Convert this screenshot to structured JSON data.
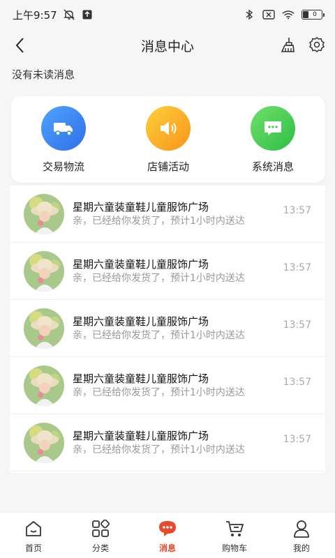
{
  "status_bar": {
    "time": "上午9:57",
    "battery_level": "0"
  },
  "header": {
    "title": "消息中心"
  },
  "unread_text": "没有未读消息",
  "categories": [
    {
      "label": "交易物流",
      "color": "#3a86f0",
      "icon": "truck-icon"
    },
    {
      "label": "店铺活动",
      "color": "#f7a51b",
      "icon": "speaker-icon"
    },
    {
      "label": "系统消息",
      "color": "#3ec94e",
      "icon": "chat-bubble-icon"
    }
  ],
  "messages": [
    {
      "name": "星期六童装童鞋儿童服饰广场",
      "preview": "亲，已经给你发货了，预计1小时内送达",
      "time": "13:57"
    },
    {
      "name": "星期六童装童鞋儿童服饰广场",
      "preview": "亲，已经给你发货了，预计1小时内送达",
      "time": "13:57"
    },
    {
      "name": "星期六童装童鞋儿童服饰广场",
      "preview": "亲，已经给你发货了，预计1小时内送达",
      "time": "13:57"
    },
    {
      "name": "星期六童装童鞋儿童服饰广场",
      "preview": "亲，已经给你发货了，预计1小时内送达",
      "time": "13:57"
    },
    {
      "name": "星期六童装童鞋儿童服饰广场",
      "preview": "亲，已经给你发货了，预计1小时内送达",
      "time": "13:57"
    }
  ],
  "tabs": [
    {
      "label": "首页",
      "icon": "home-icon",
      "active": false
    },
    {
      "label": "分类",
      "icon": "grid-icon",
      "active": false
    },
    {
      "label": "消息",
      "icon": "message-icon",
      "active": true
    },
    {
      "label": "购物车",
      "icon": "cart-icon",
      "active": false
    },
    {
      "label": "我的",
      "icon": "person-icon",
      "active": false
    }
  ],
  "colors": {
    "accent": "#e8482b",
    "background": "#f6f6f6"
  }
}
